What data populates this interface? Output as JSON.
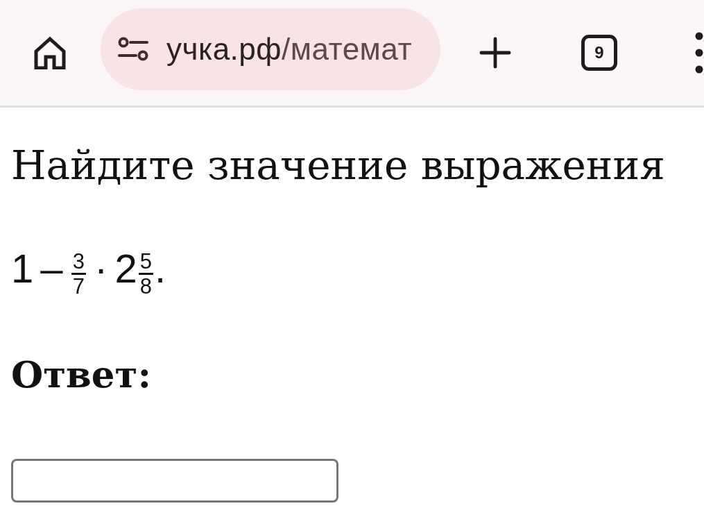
{
  "browser_toolbar": {
    "url": {
      "host": "учка.рф",
      "path": "/математ"
    },
    "tab_count": "9"
  },
  "task": {
    "heading": "Найдите значение выражения",
    "expression": [
      {
        "kind": "text",
        "text": "1 – "
      },
      {
        "kind": "fraction",
        "numerator": "3",
        "denominator": "7"
      },
      {
        "kind": "text",
        "text": " · 2"
      },
      {
        "kind": "fraction",
        "numerator": "5",
        "denominator": "8"
      },
      {
        "kind": "text",
        "text": "."
      }
    ],
    "answer_label": "Ответ:"
  }
}
